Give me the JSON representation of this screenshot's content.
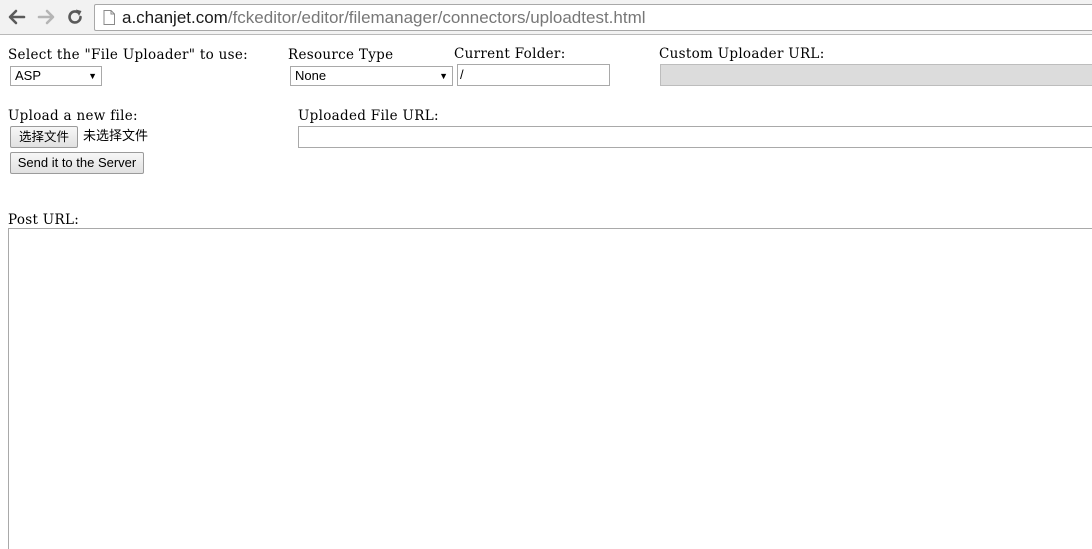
{
  "browser": {
    "url_host": "a.chanjet.com",
    "url_path": "/fckeditor/editor/filemanager/connectors/uploadtest.html",
    "back_icon": "back-arrow-icon",
    "forward_icon": "forward-arrow-icon",
    "reload_icon": "reload-icon",
    "page_icon": "page-icon"
  },
  "form": {
    "uploader_label": "Select the \"File Uploader\" to use:",
    "uploader_value": "ASP",
    "resource_type_label": "Resource Type",
    "resource_type_value": "None",
    "current_folder_label": "Current Folder:",
    "current_folder_value": "/",
    "custom_url_label": "Custom Uploader URL:",
    "custom_url_value": "",
    "upload_label": "Upload a new file:",
    "choose_file_button": "选择文件",
    "no_file_text": "未选择文件",
    "send_button": "Send it to the Server",
    "uploaded_url_label": "Uploaded File URL:",
    "uploaded_url_value": "",
    "post_url_label": "Post URL:",
    "post_url_value": ""
  }
}
